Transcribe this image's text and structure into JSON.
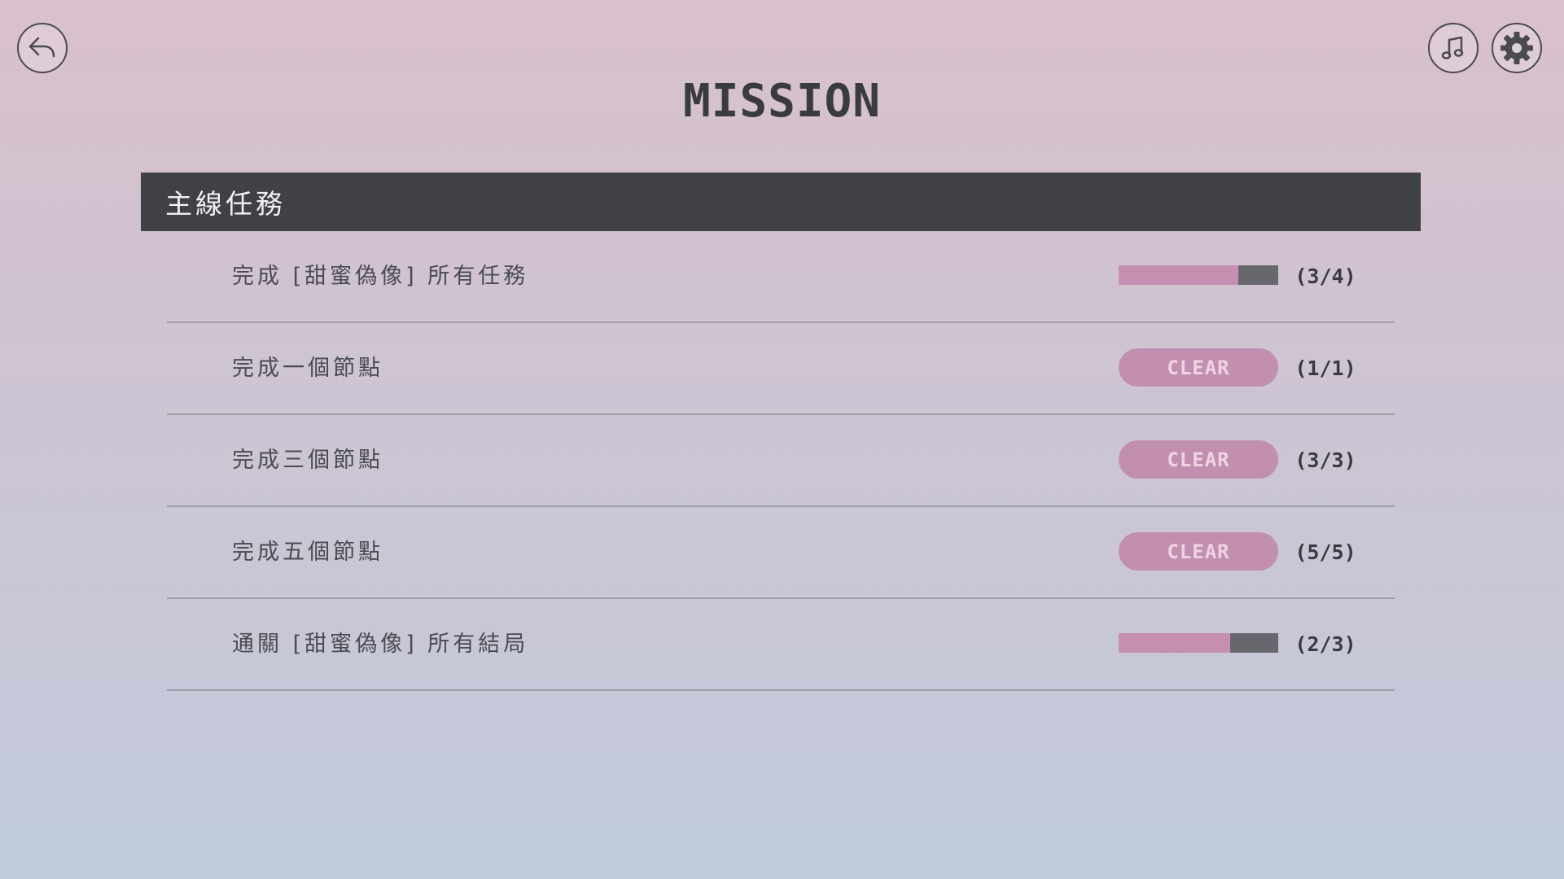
{
  "header": {
    "title": "MISSION",
    "back_icon": "back-arrow-icon",
    "music_icon": "music-note-icon",
    "settings_icon": "gear-icon"
  },
  "section": {
    "title": "主線任務"
  },
  "missions": [
    {
      "label": "完成 [甜蜜偽像] 所有任務",
      "status": "progress",
      "progress": 0.75,
      "count": "(3/4)"
    },
    {
      "label": "完成一個節點",
      "status": "clear",
      "badge": "CLEAR",
      "count": "(1/1)"
    },
    {
      "label": "完成三個節點",
      "status": "clear",
      "badge": "CLEAR",
      "count": "(3/3)"
    },
    {
      "label": "完成五個節點",
      "status": "clear",
      "badge": "CLEAR",
      "count": "(5/5)"
    },
    {
      "label": "通關 [甜蜜偽像] 所有結局",
      "status": "progress",
      "progress": 0.7,
      "count": "(2/3)"
    }
  ],
  "colors": {
    "accent_pink": "#c28fb0",
    "progress_track": "#67686e",
    "header_bar": "#404145"
  }
}
